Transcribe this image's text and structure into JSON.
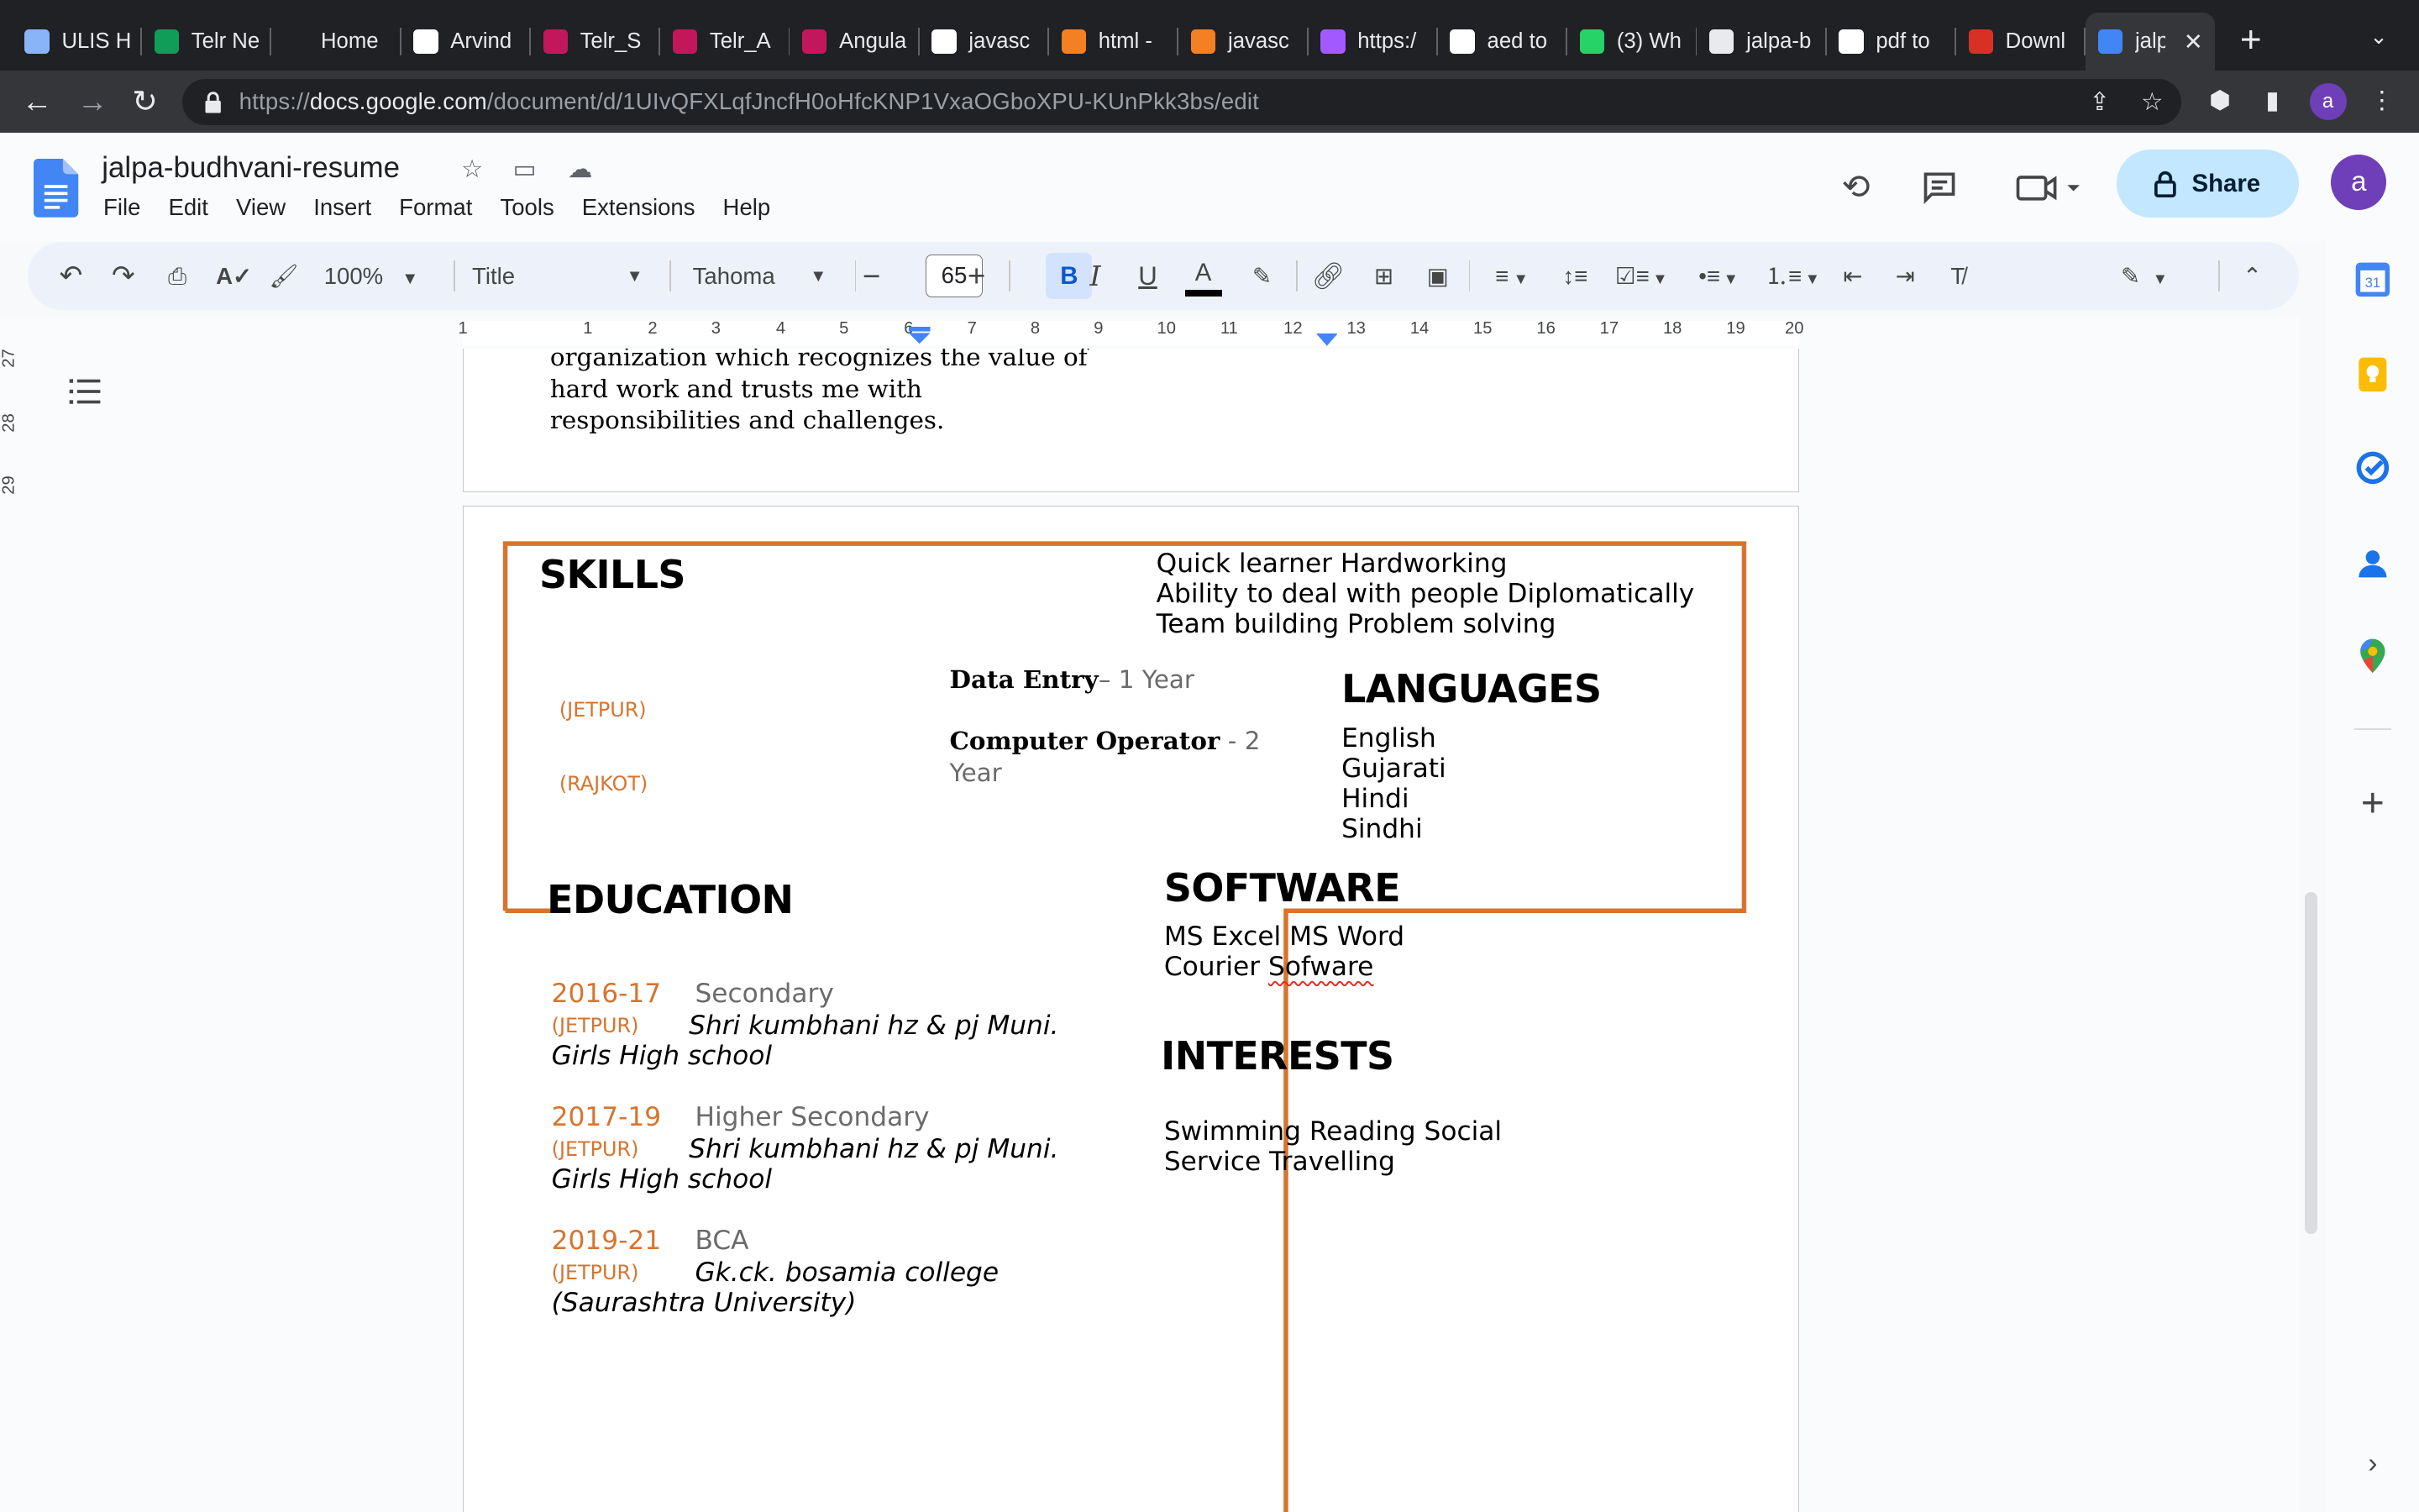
{
  "browser": {
    "tabs": [
      {
        "label": "ULIS H",
        "icon": "ulis-favicon",
        "color": "#8ab4f8"
      },
      {
        "label": "Telr Ne",
        "icon": "sheets-favicon",
        "color": "#0f9d58"
      },
      {
        "label": "Home",
        "icon": "notion-favicon",
        "color": "#202124"
      },
      {
        "label": "Arvind",
        "icon": "github-favicon",
        "color": "#ffffff"
      },
      {
        "label": "Telr_S",
        "icon": "telr-favicon",
        "color": "#c2185b"
      },
      {
        "label": "Telr_A",
        "icon": "telr-favicon",
        "color": "#c2185b"
      },
      {
        "label": "Angula",
        "icon": "telr-favicon",
        "color": "#c2185b"
      },
      {
        "label": "javasc",
        "icon": "google-favicon",
        "color": "#ffffff"
      },
      {
        "label": "html -",
        "icon": "stackoverflow-favicon",
        "color": "#f48024"
      },
      {
        "label": "javasc",
        "icon": "stackoverflow-favicon",
        "color": "#f48024"
      },
      {
        "label": "https:/",
        "icon": "figma-favicon",
        "color": "#a259ff"
      },
      {
        "label": "aed to",
        "icon": "google-favicon",
        "color": "#ffffff"
      },
      {
        "label": "(3) Wh",
        "icon": "whatsapp-favicon",
        "color": "#25d366"
      },
      {
        "label": "jalpa-b",
        "icon": "globe-favicon",
        "color": "#e8eaed"
      },
      {
        "label": "pdf to",
        "icon": "google-favicon",
        "color": "#ffffff"
      },
      {
        "label": "Downl",
        "icon": "heart-favicon",
        "color": "#d93025"
      },
      {
        "label": "jalp",
        "icon": "docs-favicon",
        "color": "#4285f4"
      }
    ],
    "url_prefix": "https://",
    "url_host": "docs.google.com",
    "url_path": "/document/d/1UIvQFXLqfJncfH0oHfcKNP1VxaOGboXPU-KUnPkk3bs/edit",
    "profile_initial": "a"
  },
  "docs": {
    "title": "jalpa-budhvani-resume",
    "menu": [
      "File",
      "Edit",
      "View",
      "Insert",
      "Format",
      "Tools",
      "Extensions",
      "Help"
    ],
    "share_label": "Share",
    "account_initial": "a",
    "toolbar": {
      "zoom": "100%",
      "style": "Title",
      "font": "Tahoma",
      "font_size": "65",
      "bold": "B",
      "italic": "I",
      "underline": "U",
      "text_color": "A"
    },
    "ruler_h": [
      "1",
      "1",
      "2",
      "3",
      "4",
      "5",
      "6",
      "7",
      "8",
      "9",
      "10",
      "11",
      "12",
      "13",
      "14",
      "15",
      "16",
      "17",
      "18",
      "19",
      "20"
    ],
    "ruler_v": [
      "27",
      "28",
      "29"
    ]
  },
  "resume": {
    "objective_lines": [
      "organization which recognizes the value of",
      "hard work and trusts me with",
      "responsibilities and challenges."
    ],
    "skills_heading": "SKILLS",
    "skills_lines": [
      "Quick learner Hardworking",
      "Ability to deal with people Diplomatically",
      "Team building Problem solving"
    ],
    "experience": [
      {
        "location": "(JETPUR)",
        "role": "Data Entry",
        "duration": "– 1 Year"
      },
      {
        "location": "(RAJKOT)",
        "role": "Computer Operator",
        "duration": " - 2",
        "duration_cont": "Year"
      }
    ],
    "languages_heading": "LANGUAGES",
    "languages": [
      "English",
      "Gujarati",
      "Hindi",
      "Sindhi"
    ],
    "education_heading": "EDUCATION",
    "education": [
      {
        "years": "2016-17",
        "level": "Secondary",
        "location": "(JETPUR)",
        "school_line1": "Shri kumbhani hz & pj Muni.",
        "school_line2": "Girls High school"
      },
      {
        "years": "2017-19",
        "level": "Higher Secondary",
        "location": "(JETPUR)",
        "school_line1": "Shri kumbhani hz & pj Muni.",
        "school_line2": "Girls High school"
      },
      {
        "years": "2019-21",
        "level": "BCA",
        "location": "(JETPUR)",
        "school_line1": "Gk.ck. bosamia college",
        "school_line2": "(Saurashtra University)"
      }
    ],
    "software_heading": "SOFTWARE",
    "software_line1": "MS Excel MS Word",
    "software_line2_a": "Courier ",
    "software_line2_b": "Sofware",
    "interests_heading": "INTERESTS",
    "interests_lines": [
      "Swimming Reading Social",
      "Service Travelling"
    ],
    "accent_color": "#d7742f"
  }
}
